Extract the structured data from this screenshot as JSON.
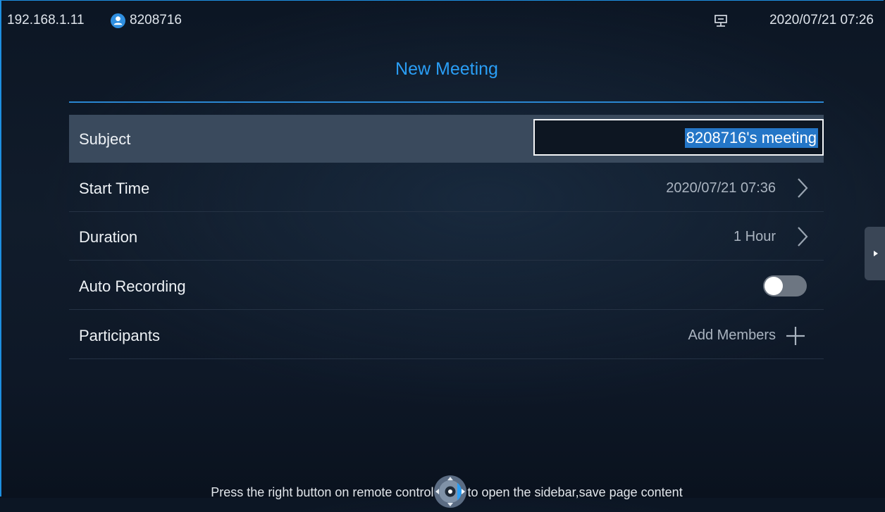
{
  "status": {
    "ip": "192.168.1.11",
    "extension": "8208716",
    "datetime": "2020/07/21 07:26",
    "user_icon": "user-icon",
    "network_icon": "network-icon"
  },
  "page": {
    "title": "New Meeting"
  },
  "form": {
    "subject": {
      "label": "Subject",
      "value": "8208716's meeting"
    },
    "start_time": {
      "label": "Start Time",
      "value": "2020/07/21 07:36"
    },
    "duration": {
      "label": "Duration",
      "value": "1 Hour"
    },
    "auto_recording": {
      "label": "Auto Recording",
      "enabled": false
    },
    "participants": {
      "label": "Participants",
      "action": "Add Members"
    }
  },
  "hint": {
    "before": "Press the right button on remote control",
    "after": "to open the sidebar,save page content"
  },
  "colors": {
    "accent": "#2a9ef5",
    "selected_row": "#3a4a5d",
    "highlight": "#2476c7"
  }
}
